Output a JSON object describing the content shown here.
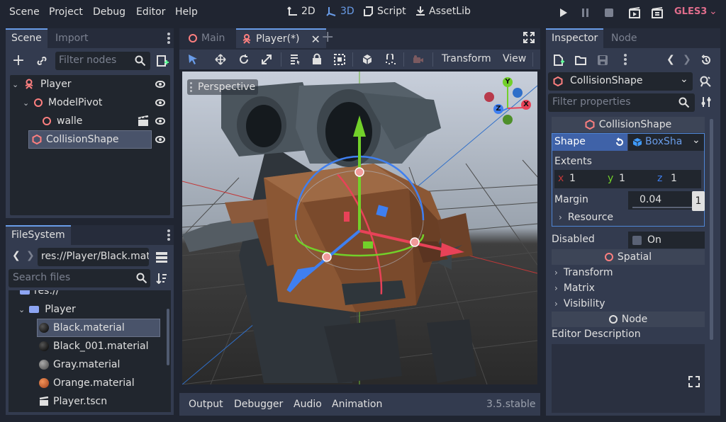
{
  "menu": {
    "scene": "Scene",
    "project": "Project",
    "debug": "Debug",
    "editor": "Editor",
    "help": "Help"
  },
  "workspaces": {
    "w2d": "2D",
    "w3d": "3D",
    "script": "Script",
    "assetlib": "AssetLib"
  },
  "renderer": "GLES3",
  "scene_dock": {
    "tab_scene": "Scene",
    "tab_import": "Import",
    "filter_placeholder": "Filter nodes",
    "nodes": [
      {
        "label": "Player"
      },
      {
        "label": "ModelPivot"
      },
      {
        "label": "walle"
      },
      {
        "label": "CollisionShape"
      }
    ]
  },
  "filesystem": {
    "tab": "FileSystem",
    "path": "res://Player/Black.mat",
    "search_placeholder": "Search files",
    "root": "res://",
    "folder": "Player",
    "files": [
      {
        "label": "Black.material",
        "color": "#111111"
      },
      {
        "label": "Black_001.material",
        "color": "#151515"
      },
      {
        "label": "Gray.material",
        "color": "#6b6b6b"
      },
      {
        "label": "Orange.material",
        "color": "#d5622a"
      },
      {
        "label": "Player.tscn"
      }
    ]
  },
  "editor_tabs": {
    "main": "Main",
    "player": "Player(*)"
  },
  "toolbar3d": {
    "transform": "Transform",
    "view": "View"
  },
  "viewport": {
    "perspective": "Perspective",
    "gizmo_y": "Y",
    "gizmo_z": "Z",
    "gizmo_x": "X"
  },
  "bottom": {
    "output": "Output",
    "debugger": "Debugger",
    "audio": "Audio",
    "animation": "Animation",
    "version": "3.5.stable"
  },
  "inspector": {
    "tab_inspector": "Inspector",
    "tab_node": "Node",
    "object": "CollisionShape",
    "filter_placeholder": "Filter properties",
    "class_header": "CollisionShape",
    "shape_label": "Shape",
    "shape_value": "BoxSha",
    "extents_label": "Extents",
    "x_label": "x",
    "x_value": "1",
    "y_label": "y",
    "y_value": "1",
    "z_label": "z",
    "z_value": "1",
    "margin_label": "Margin",
    "margin_value": "0.04",
    "margin_side": "1",
    "resource_label": "Resource",
    "disabled_label": "Disabled",
    "disabled_value": "On",
    "spatial_header": "Spatial",
    "transform": "Transform",
    "matrix": "Matrix",
    "visibility": "Visibility",
    "node_header": "Node",
    "editor_description": "Editor Description"
  },
  "colors": {
    "accent": "#699ce8",
    "bg": "#202531",
    "panel": "#333b4f",
    "renderer": "#e06d8c"
  }
}
